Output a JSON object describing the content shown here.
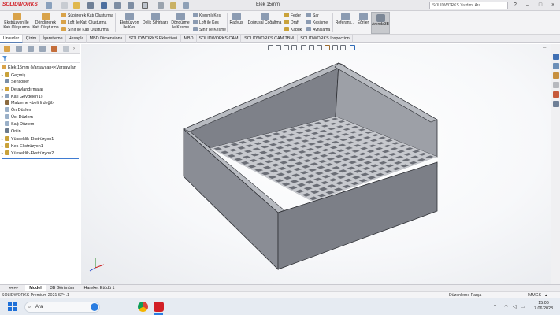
{
  "app": {
    "logo_text": "SOLIDWORKS",
    "document_title": "Elek 15mm",
    "search_placeholder": "SOLIDWORKS Yardımı Ara",
    "window_controls": [
      "?",
      "–",
      "□",
      "×"
    ]
  },
  "ribbon": {
    "big_buttons": [
      {
        "label": "Ekstrüzyon İle\nKatı Oluşturma",
        "icon": "extrude-icon"
      },
      {
        "label": "Döndürerek\nKatı Oluşturma",
        "icon": "revolve-icon"
      },
      {
        "label": "Ekstrüzyon\nİle Kes",
        "icon": "extrude-cut-icon"
      },
      {
        "label": "Delik Sihirbazı",
        "icon": "hole-wizard-icon"
      },
      {
        "label": "Döndürme\nile Kesme",
        "icon": "revolve-cut-icon"
      },
      {
        "label": "Radyus",
        "icon": "fillet-icon"
      },
      {
        "label": "Doğrusal Çoğaltma",
        "icon": "linear-pattern-icon"
      },
      {
        "label": "Referans...",
        "icon": "reference-geometry-icon"
      },
      {
        "label": "Eğriler",
        "icon": "curves-icon"
      },
      {
        "label": "Anında3B",
        "icon": "instant3d-icon"
      }
    ],
    "small_buttons": [
      {
        "label": "Süpürerek Katı Oluşturma",
        "icon": "sweep-icon"
      },
      {
        "label": "Loft ile Katı Oluşturma",
        "icon": "loft-icon"
      },
      {
        "label": "Sınır ile Katı Oluşturma",
        "icon": "boundary-icon"
      },
      {
        "label": "Kıvrımlı Kes",
        "icon": "swept-cut-icon"
      },
      {
        "label": "Loft ile Kes",
        "icon": "lofted-cut-icon"
      },
      {
        "label": "Sınır ile Kesme",
        "icon": "boundary-cut-icon"
      },
      {
        "label": "Feder",
        "icon": "rib-icon"
      },
      {
        "label": "Draft",
        "icon": "draft-icon"
      },
      {
        "label": "Kabuk",
        "icon": "shell-icon"
      },
      {
        "label": "Sar",
        "icon": "wrap-icon"
      },
      {
        "label": "Kesişme",
        "icon": "intersect-icon"
      },
      {
        "label": "Aynalama",
        "icon": "mirror-icon"
      }
    ]
  },
  "tabs": [
    "Unsurlar",
    "Çizim",
    "İşaretleme",
    "Hesapla",
    "MBD Dimensions",
    "SOLIDWORKS Eklentileri",
    "MBD",
    "SOLIDWORKS CAM",
    "SOLIDWORKS CAM TBM",
    "SOLIDWORKS Inspection"
  ],
  "feature_tree": {
    "root": "Elek 15mm  (Varsayılan<<Varsayılan",
    "items": [
      {
        "label": "Geçmiş",
        "arrow": "▸",
        "icon_color": "#c9a23a"
      },
      {
        "label": "Sensörler",
        "arrow": "",
        "icon_color": "#7a8fa8"
      },
      {
        "label": "Detaylandırmalar",
        "arrow": "▸",
        "icon_color": "#d0a23a"
      },
      {
        "label": "Katı Gövdeler(1)",
        "arrow": "▸",
        "icon_color": "#8da3bd"
      },
      {
        "label": "Malzeme <belirli değil>",
        "arrow": "",
        "icon_color": "#8b6a3e"
      },
      {
        "label": "Ön Düzlem",
        "arrow": "",
        "icon_color": "#9ab0c8"
      },
      {
        "label": "Üst Düzlem",
        "arrow": "",
        "icon_color": "#9ab0c8"
      },
      {
        "label": "Sağ Düzlem",
        "arrow": "",
        "icon_color": "#9ab0c8"
      },
      {
        "label": "Orijin",
        "arrow": "",
        "icon_color": "#6b7a8c"
      },
      {
        "label": "Yükseklik-Ekstrüzyon1",
        "arrow": "▸",
        "icon_color": "#c9a23a"
      },
      {
        "label": "Kes-Ekstrüzyon1",
        "arrow": "▸",
        "icon_color": "#c9a23a"
      },
      {
        "label": "Yükseklik-Ekstrüzyon2",
        "arrow": "▸",
        "icon_color": "#c9a23a"
      }
    ]
  },
  "bottom_tabs": [
    "Model",
    "3B Görünüm",
    "Hareket Etüdü 1"
  ],
  "status": {
    "left": "SOLIDWORKS Premium 2021 SP4.1",
    "mode": "Düzenleme Parça",
    "units": "MMGS"
  },
  "taskbar": {
    "search_placeholder": "Ara",
    "time": "15:06",
    "date": "7.06.2023"
  },
  "colors": {
    "accent": "#d21f26",
    "model_face": "#8e9199",
    "model_top": "#a3a6ad",
    "active_tab_underline": "#5a7fb5"
  }
}
